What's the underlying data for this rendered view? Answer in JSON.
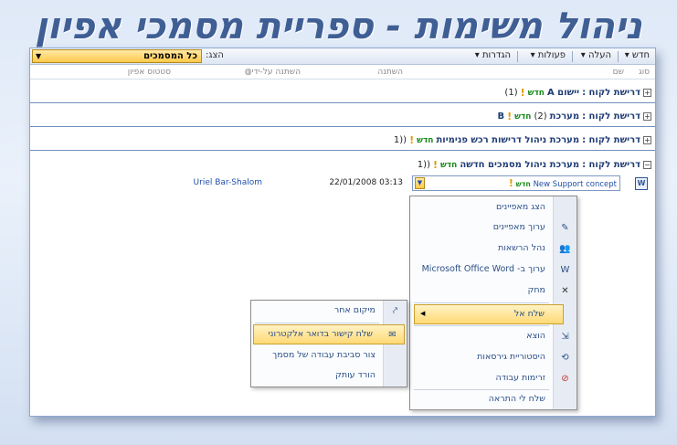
{
  "slide_title": "ניהול משימות - ספריית מסמכי אפיון",
  "toolbar": {
    "items": [
      "חדש",
      "העלה",
      "פעולות",
      "הגדרות"
    ],
    "view_label": "הצג:",
    "view_value": "כל המסמכים"
  },
  "columns": {
    "type": "סוג",
    "name": "שם",
    "modified": "השתנה",
    "modified_by": "השתנה על-ידי",
    "spec_status": "סטטוס אפיון"
  },
  "groups": [
    {
      "label": "דרישת לקוח :",
      "value": "יישום A",
      "badge": "חדש",
      "bang": "!",
      "count": "(1)"
    },
    {
      "label": "דרישת לקוח :",
      "value": "מערכת",
      "count": "(2)",
      "badge": "חדש",
      "bang": "!",
      "suffix": "B"
    },
    {
      "label": "דרישת לקוח :",
      "value": "מערכת ניהול דרישות רכש פנימיות",
      "badge": "חדש",
      "bang": "!",
      "count": "((1"
    },
    {
      "label": "דרישת לקוח :",
      "value": "מערכת ניהול מסמכים חדשה",
      "badge": "חדש",
      "bang": "!",
      "count": "((1"
    }
  ],
  "item": {
    "name": "New Support concept",
    "badge": "חדש",
    "bang": "!",
    "modified": "03:13 22/01/2008",
    "modified_by": "Uriel Bar-Shalom"
  },
  "context_menu": {
    "items": [
      {
        "label": "הצג מאפיינים",
        "icon": "none"
      },
      {
        "label": "ערוך מאפיינים",
        "icon": "edit-properties-icon"
      },
      {
        "label": "נהל הרשאות",
        "icon": "permissions-icon"
      },
      {
        "label": "ערוך ב- Microsoft Office Word",
        "icon": "word-icon"
      },
      {
        "label": "מחק",
        "icon": "delete-icon"
      },
      {
        "label": "שלח אל",
        "icon": "none"
      },
      {
        "label": "הוצא",
        "icon": "checkout-icon"
      },
      {
        "label": "היסטוריית גירסאות",
        "icon": "version-history-icon"
      },
      {
        "label": "זרימות עבודה",
        "icon": "workflow-icon"
      },
      {
        "label": "שלח לי התראה",
        "icon": "none"
      }
    ]
  },
  "submenu": {
    "items": [
      {
        "label": "מיקום אחר",
        "icon": "other-location-icon"
      },
      {
        "label": "שלח קישור בדואר אלקטרוני",
        "icon": "email-link-icon"
      },
      {
        "label": "צור סביבת עבודה של מסמך",
        "icon": "none"
      },
      {
        "label": "הורד עותק",
        "icon": "none"
      }
    ]
  },
  "colors": {
    "title": "#3f5e94",
    "group_text": "#1f3c75",
    "new_badge": "#1a8a1a",
    "highlight": "#ffd975"
  }
}
